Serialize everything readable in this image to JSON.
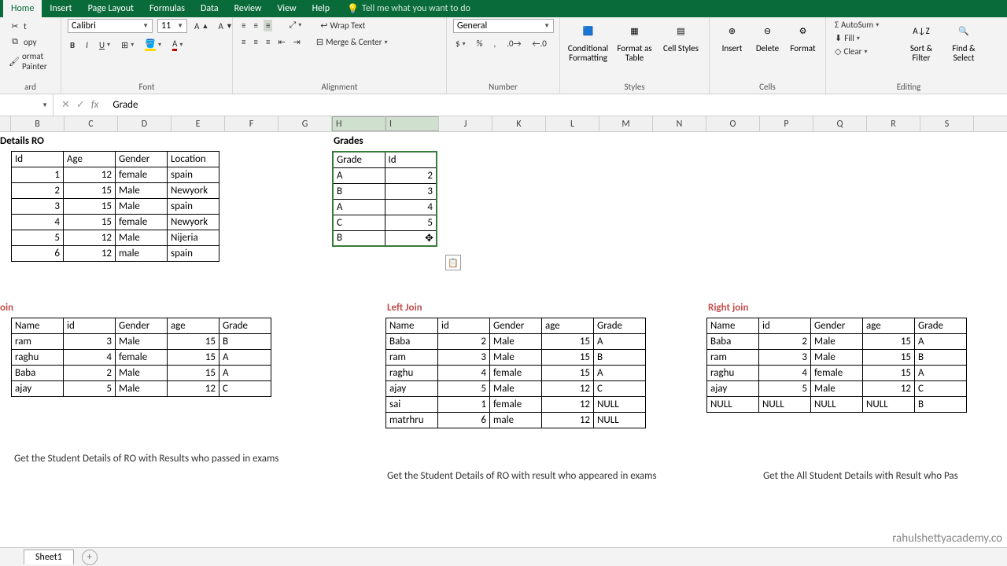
{
  "tabs": {
    "home": "Home",
    "insert": "Insert",
    "layout": "Page Layout",
    "formulas": "Formulas",
    "data": "Data",
    "review": "Review",
    "view": "View",
    "help": "Help",
    "tell": "Tell me what you want to do"
  },
  "clipboard": {
    "cut": "t",
    "copy": "opy",
    "painter": "ormat Painter",
    "label": "ard"
  },
  "font": {
    "name": "Calibri",
    "size": "11",
    "label": "Font"
  },
  "align": {
    "wrap": "Wrap Text",
    "merge": "Merge & Center",
    "label": "Alignment"
  },
  "number": {
    "fmt": "General",
    "label": "Number"
  },
  "styles": {
    "cond": "Conditional Formatting",
    "fmtas": "Format as Table",
    "cell": "Cell Styles",
    "label": "Styles"
  },
  "cells": {
    "ins": "Insert",
    "del": "Delete",
    "fmt": "Format",
    "label": "Cells"
  },
  "editing": {
    "sum": "AutoSum",
    "fill": "Fill",
    "clear": "Clear",
    "sort": "Sort & Filter",
    "find": "Find & Select",
    "label": "Editing"
  },
  "formula": {
    "fx": "fx",
    "value": "Grade"
  },
  "cols": [
    "B",
    "C",
    "D",
    "E",
    "F",
    "G",
    "H",
    "I",
    "J",
    "K",
    "L",
    "M",
    "N",
    "O",
    "P",
    "Q",
    "R",
    "S"
  ],
  "detailsTitle": "Details RO",
  "details": {
    "headers": [
      "Id",
      "Age",
      "Gender",
      "Location"
    ],
    "rows": [
      [
        "1",
        "12",
        "female",
        "spain"
      ],
      [
        "2",
        "15",
        "Male",
        "Newyork"
      ],
      [
        "3",
        "15",
        "Male",
        "spain"
      ],
      [
        "4",
        "15",
        "female",
        "Newyork"
      ],
      [
        "5",
        "12",
        "Male",
        "Nijeria"
      ],
      [
        "6",
        "12",
        "male",
        "spain"
      ]
    ]
  },
  "gradesTitle": "Grades",
  "grades": {
    "headers": [
      "Grade",
      "Id"
    ],
    "rows": [
      [
        "A",
        "2"
      ],
      [
        "B",
        "3"
      ],
      [
        "A",
        "4"
      ],
      [
        "C",
        "5"
      ],
      [
        "B",
        ""
      ]
    ]
  },
  "joinTitle": "oin",
  "join": {
    "headers": [
      "Name",
      "id",
      "Gender",
      "age",
      "Grade"
    ],
    "rows": [
      [
        "ram",
        "3",
        "Male",
        "15",
        "B"
      ],
      [
        "raghu",
        "4",
        "female",
        "15",
        "A"
      ],
      [
        "Baba",
        "2",
        "Male",
        "15",
        "A"
      ],
      [
        "ajay",
        "5",
        "Male",
        "12",
        "C"
      ]
    ]
  },
  "leftTitle": "Left Join",
  "left": {
    "headers": [
      "Name",
      "id",
      "Gender",
      "age",
      "Grade"
    ],
    "rows": [
      [
        "Baba",
        "2",
        "Male",
        "15",
        "A"
      ],
      [
        "ram",
        "3",
        "Male",
        "15",
        "B"
      ],
      [
        "raghu",
        "4",
        "female",
        "15",
        "A"
      ],
      [
        "ajay",
        "5",
        "Male",
        "12",
        "C"
      ],
      [
        "sai",
        "1",
        "female",
        "12",
        "NULL"
      ],
      [
        "matrhru",
        "6",
        "male",
        "12",
        "NULL"
      ]
    ]
  },
  "rightTitle": "Right join",
  "right": {
    "headers": [
      "Name",
      "id",
      "Gender",
      "age",
      "Grade"
    ],
    "rows": [
      [
        "Baba",
        "2",
        "Male",
        "15",
        "A"
      ],
      [
        "ram",
        "3",
        "Male",
        "15",
        "B"
      ],
      [
        "raghu",
        "4",
        "female",
        "15",
        "A"
      ],
      [
        "ajay",
        "5",
        "Male",
        "12",
        "C"
      ],
      [
        "NULL",
        "NULL",
        "NULL",
        "NULL",
        "B"
      ]
    ]
  },
  "q1": "Get the Student Details of RO with Results who passed in exams",
  "q2": "Get the Student Details of RO with result who appeared in exams",
  "q3": "Get the All  Student Details with Result who Pas",
  "sheet": "Sheet1",
  "watermark": "rahulshettyacademy.co"
}
